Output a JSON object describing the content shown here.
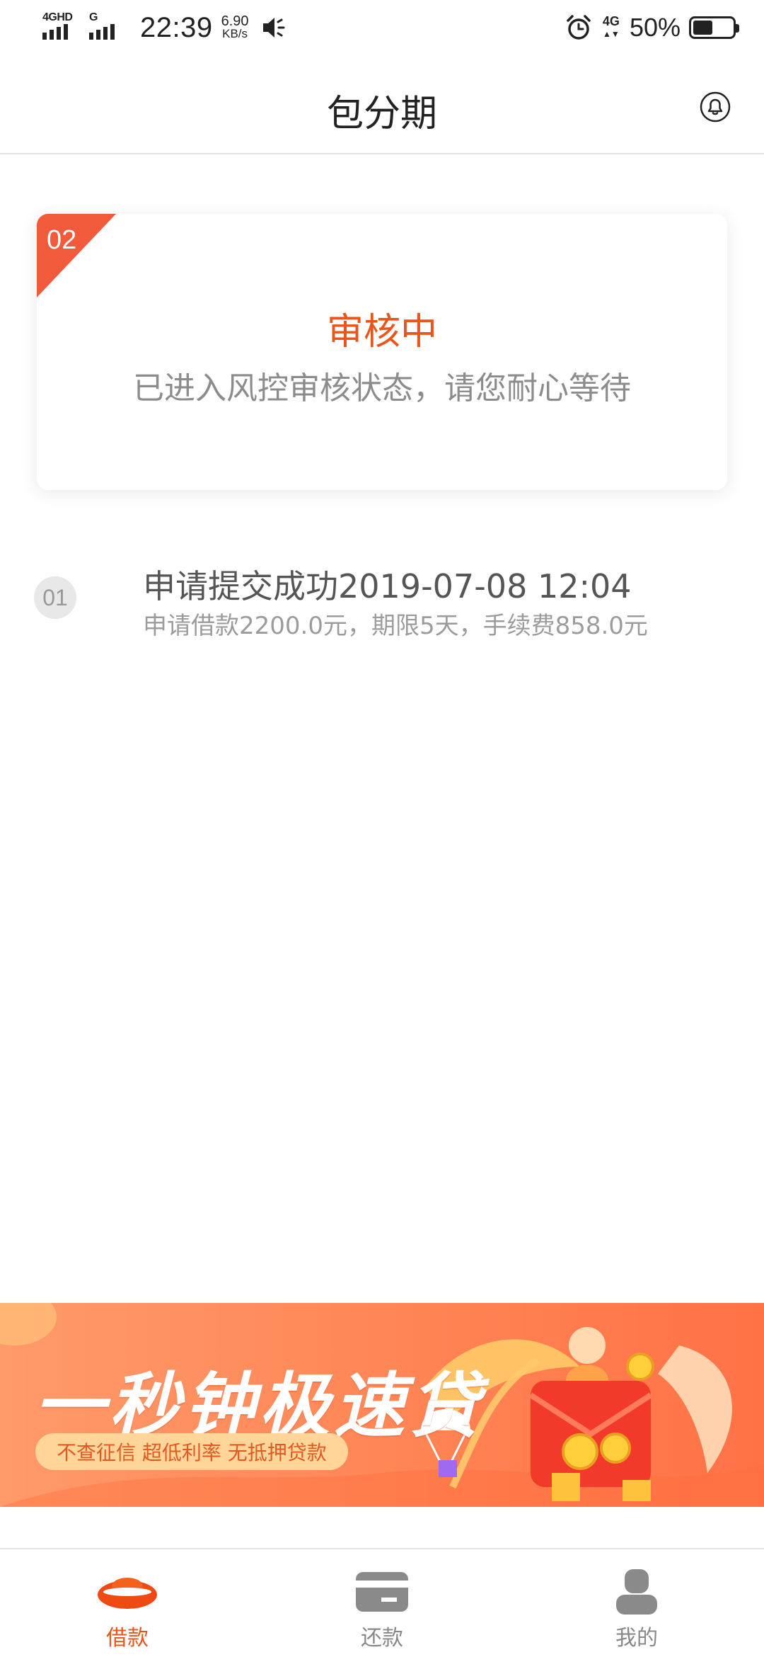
{
  "status_bar": {
    "sim1_tag": "4GHD",
    "sim2_tag": "G",
    "time": "22:39",
    "speed_value": "6.90",
    "speed_unit": "KB/s",
    "network": "4G",
    "battery_percent": "50%",
    "battery_level": 0.5
  },
  "header": {
    "title": "包分期",
    "bell_icon": "bell-icon"
  },
  "review_card": {
    "step_number": "02",
    "status": "审核中",
    "description": "已进入风控审核状态，请您耐心等待",
    "accent_color": "#e8561b"
  },
  "timeline": {
    "step_number": "01",
    "title": "申请提交成功2019-07-08 12:04",
    "subtitle": "申请借款2200.0元，期限5天，手续费858.0元"
  },
  "banner": {
    "title": "一秒钟极速贷",
    "tagline": "不查征信 超低利率 无抵押贷款"
  },
  "bottom_nav": {
    "items": [
      {
        "label": "借款",
        "icon": "ingot-icon",
        "active": true
      },
      {
        "label": "还款",
        "icon": "card-icon",
        "active": false
      },
      {
        "label": "我的",
        "icon": "user-icon",
        "active": false
      }
    ]
  }
}
